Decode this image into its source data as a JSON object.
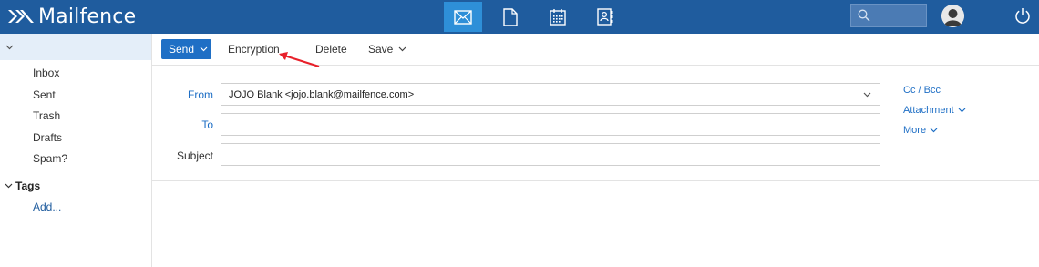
{
  "header": {
    "brand": "Mailfence",
    "apps": [
      {
        "name": "mail",
        "icon": "mail-icon",
        "active": true
      },
      {
        "name": "documents",
        "icon": "document-icon",
        "active": false
      },
      {
        "name": "calendar",
        "icon": "calendar-icon",
        "active": false
      },
      {
        "name": "contacts",
        "icon": "contacts-icon",
        "active": false
      }
    ],
    "search_placeholder": "",
    "colors": {
      "bar": "#1f5c9e",
      "active_app": "#2e8fd8"
    }
  },
  "sidebar": {
    "folders": [
      "Inbox",
      "Sent",
      "Trash",
      "Drafts",
      "Spam?"
    ],
    "tags_label": "Tags",
    "add_label": "Add..."
  },
  "toolbar": {
    "send_label": "Send",
    "encryption_label": "Encryption",
    "delete_label": "Delete",
    "save_label": "Save"
  },
  "compose": {
    "from_label": "From",
    "from_value": "JOJO Blank <jojo.blank@mailfence.com>",
    "to_label": "To",
    "to_value": "",
    "subject_label": "Subject",
    "subject_value": "",
    "cc_bcc_label": "Cc / Bcc",
    "attachment_label": "Attachment",
    "more_label": "More"
  },
  "annotation": {
    "arrow_color": "#e8202a"
  }
}
